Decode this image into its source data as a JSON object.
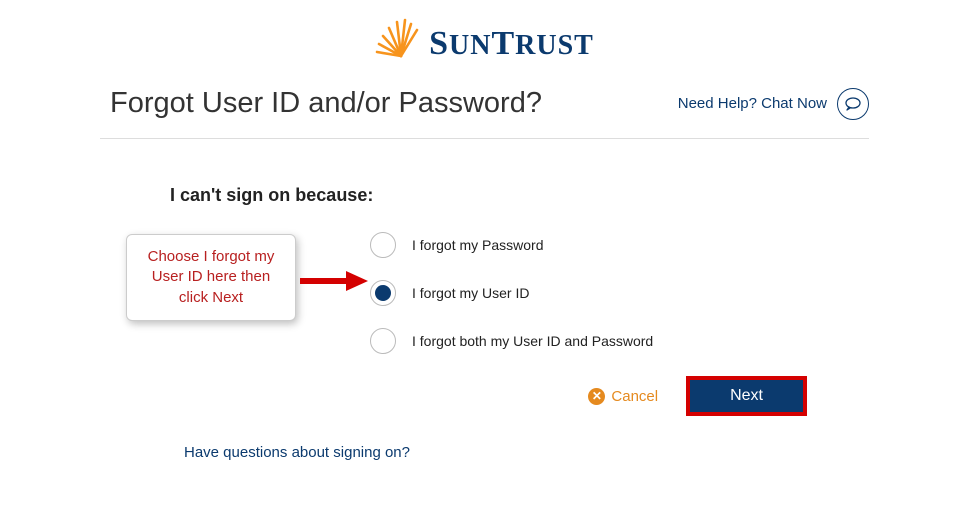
{
  "logo": {
    "name": "SUNTRUST"
  },
  "header": {
    "title": "Forgot User ID and/or Password?",
    "chat_label": "Need Help? Chat Now"
  },
  "form": {
    "reason_label": "I can't sign on because:",
    "options": [
      {
        "label": "I forgot my Password",
        "selected": false
      },
      {
        "label": "I forgot my User ID",
        "selected": true
      },
      {
        "label": "I forgot both my User ID and Password",
        "selected": false
      }
    ]
  },
  "callout": {
    "text": "Choose I forgot my User ID here then click Next"
  },
  "actions": {
    "cancel_label": "Cancel",
    "next_label": "Next"
  },
  "footer": {
    "questions_link": "Have questions about signing on?"
  }
}
